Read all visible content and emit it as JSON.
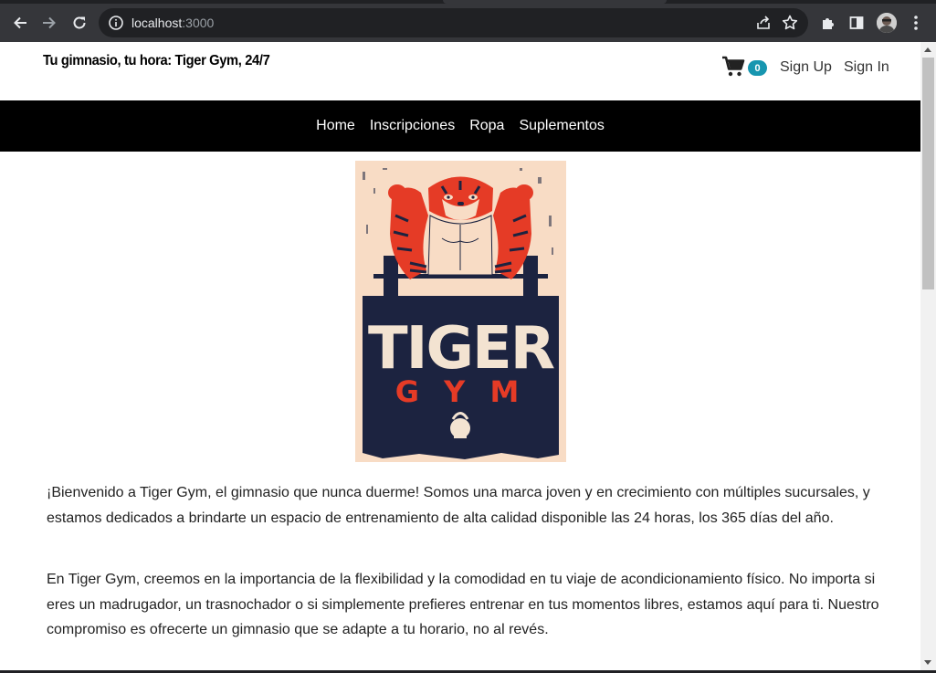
{
  "browser": {
    "url_host": "localhost",
    "url_port": ":3000"
  },
  "site": {
    "title": "Tu gimnasio, tu hora: Tiger Gym, 24/7",
    "cart_count": "0",
    "sign_up": "Sign Up",
    "sign_in": "Sign In"
  },
  "nav": {
    "items": [
      {
        "label": "Home"
      },
      {
        "label": "Inscripciones"
      },
      {
        "label": "Ropa"
      },
      {
        "label": "Suplementos"
      }
    ]
  },
  "poster": {
    "word1": "TIGER",
    "word2": "G Y M",
    "colors": {
      "background": "#f8dcc5",
      "panel": "#1c2340",
      "accent": "#e53b26",
      "text": "#f3e3d1"
    }
  },
  "content": {
    "paragraphs": [
      "¡Bienvenido a Tiger Gym, el gimnasio que nunca duerme! Somos una marca joven y en crecimiento con múltiples sucursales, y estamos dedicados a brindarte un espacio de entrenamiento de alta calidad disponible las 24 horas, los 365 días del año.",
      "En Tiger Gym, creemos en la importancia de la flexibilidad y la comodidad en tu viaje de acondicionamiento físico. No importa si eres un madrugador, un trasnochador o si simplemente prefieres entrenar en tus momentos libres, estamos aquí para ti. Nuestro compromiso es ofrecerte un gimnasio que se adapte a tu horario, no al revés."
    ]
  }
}
